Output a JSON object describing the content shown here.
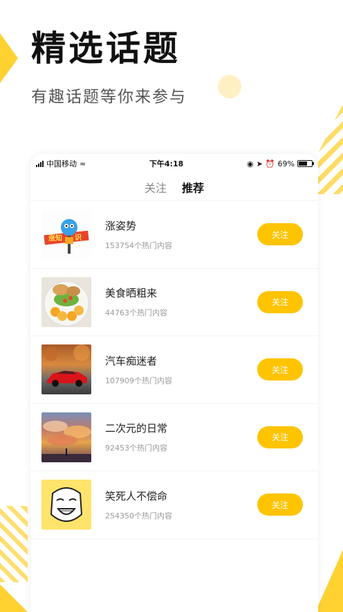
{
  "hero": {
    "title": "精选话题",
    "subtitle": "有趣话题等你来参与"
  },
  "status_bar": {
    "carrier": "中国移动",
    "time": "下午4:18",
    "battery": "69%"
  },
  "tabs": [
    {
      "label": "关注",
      "active": false
    },
    {
      "label": "推荐",
      "active": true
    }
  ],
  "topics": [
    {
      "name": "涨姿势",
      "count": "153754个热门内容",
      "follow_label": "关注",
      "thumb_icon": "knowledge-mascot-icon"
    },
    {
      "name": "美食晒粗来",
      "count": "44763个热门内容",
      "follow_label": "关注",
      "thumb_icon": "food-plate-photo"
    },
    {
      "name": "汽车痴迷者",
      "count": "107909个热门内容",
      "follow_label": "关注",
      "thumb_icon": "red-car-photo"
    },
    {
      "name": "二次元的日常",
      "count": "92453个热门内容",
      "follow_label": "关注",
      "thumb_icon": "anime-sky-photo"
    },
    {
      "name": "笑死人不偿命",
      "count": "254350个热门内容",
      "follow_label": "关注",
      "thumb_icon": "laughing-meme-face"
    }
  ],
  "colors": {
    "accent": "#ffc400",
    "deco_yellow": "#ffd232"
  }
}
